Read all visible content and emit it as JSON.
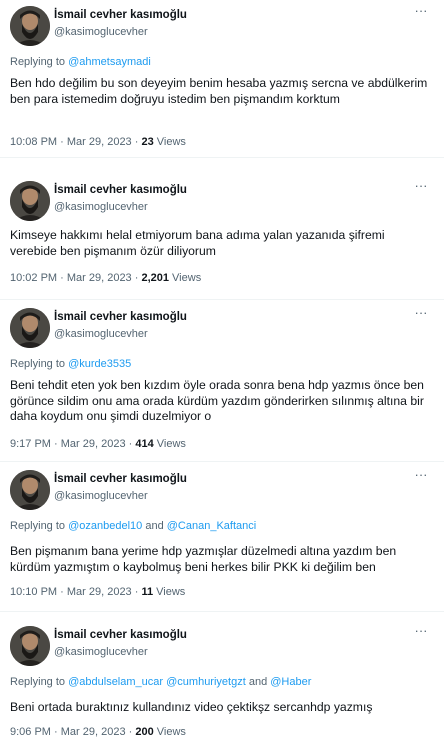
{
  "author": {
    "display_name": "İsmail cevher kasımoğlu",
    "handle": "@kasimoglucevher",
    "avatar_icon": "profile-photo-bearded-man"
  },
  "more_icon_glyph": "···",
  "replying_prefix": "Replying to",
  "and_word": "and",
  "views_label": "Views",
  "tweets": [
    {
      "replying_to": [
        "@ahmetsaymadi"
      ],
      "text": "Ben hdo değilim bu son deyeyim benim hesaba yazmış sercna ve abdülkerim ben para istemedim doğruyu istedim ben pişmandım korktum",
      "timestamp": "10:08 PM · Mar 29, 2023 · ",
      "views": "23"
    },
    {
      "replying_to": [],
      "text": "Kimseye hakkımı helal etmiyorum bana adıma yalan yazanıda şifremi verebide ben pişmanım özür diliyorum",
      "timestamp": "10:02 PM · Mar 29, 2023 · ",
      "views": "2,201"
    },
    {
      "replying_to": [
        "@kurde3535"
      ],
      "text": "Beni tehdit eten yok ben kızdım öyle orada sonra bena hdp yazmıs önce ben görünce sildim onu ama orada kürdüm yazdım gönderirken sılınmış altına bir daha koydum onu şimdi duzelmiyor o",
      "timestamp": "9:17 PM · Mar 29, 2023 · ",
      "views": "414"
    },
    {
      "replying_to": [
        "@ozanbedel10",
        "@Canan_Kaftanci"
      ],
      "text": "Ben pişmanım bana yerime hdp yazmışlar düzelmedi altına yazdım ben kürdüm yazmıştım o kaybolmuş beni herkes bilir PKK ki değilim ben",
      "timestamp": "10:10 PM · Mar 29, 2023 · ",
      "views": "11"
    },
    {
      "replying_to": [
        "@abdulselam_ucar",
        "@cumhuriyetgzt",
        "@Haber"
      ],
      "text": "Beni ortada buraktınız kullandınız video çektikşz sercanhdp yazmış",
      "timestamp": "9:06 PM · Mar 29, 2023 · ",
      "views": "200"
    }
  ],
  "colors": {
    "link": "#1d9bf0",
    "secondary_text": "#536471",
    "primary_text": "#0f1419",
    "divider": "#eff3f4"
  }
}
